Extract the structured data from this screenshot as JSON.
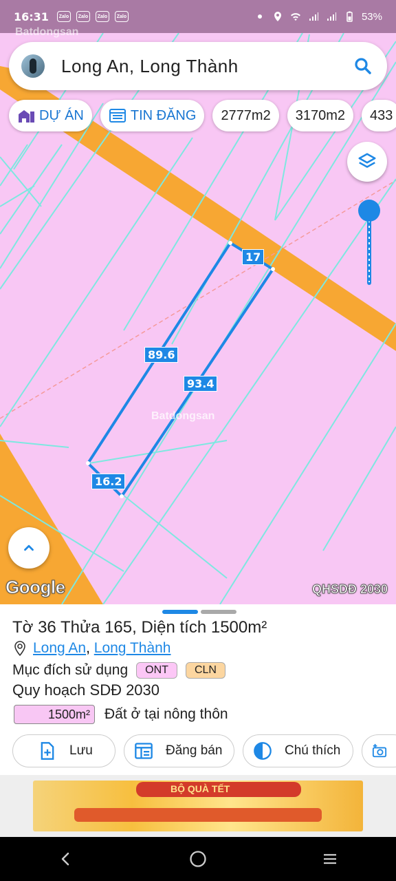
{
  "status_bar": {
    "time": "16:31",
    "notifications": [
      "Zalo",
      "Zalo",
      "Zalo",
      "Zalo"
    ],
    "battery": "53%"
  },
  "watermark": "Batdongsan",
  "search": {
    "query": "Long An, Long Thành",
    "search_icon": "search-icon"
  },
  "chips": [
    {
      "label": "DỰ ÁN",
      "icon": "building-icon",
      "accent": true
    },
    {
      "label": "TIN ĐĂNG",
      "icon": "listing-icon",
      "accent": true
    },
    {
      "label": "2777m2",
      "accent": false
    },
    {
      "label": "3170m2",
      "accent": false
    },
    {
      "label": "433",
      "accent": false
    }
  ],
  "map": {
    "edge_labels": {
      "top": "17",
      "left": "89.6",
      "right": "93.4",
      "bottom": "16.2"
    },
    "watermark": "Batdongsan",
    "google": "Google",
    "layer_name": "QHSDĐ 2030",
    "colors": {
      "residential": "#f8c7f4",
      "road": "#f7a733",
      "parcel_lines": "#7de8e0",
      "selection": "#1e88e5"
    }
  },
  "sheet": {
    "title": "Tờ 36 Thửa 165, Diện tích 1500m²",
    "location_province": "Long An",
    "location_separator": ", ",
    "location_district": "Long Thành",
    "purpose_label": "Mục đích sử dụng",
    "purpose_badges": [
      "ONT",
      "CLN"
    ],
    "planning": "Quy hoạch SDĐ 2030",
    "area_value": "1500m²",
    "area_desc": "Đất ở tại nông thôn",
    "actions": [
      {
        "label": "Lưu",
        "icon": "add-file-icon"
      },
      {
        "label": "Đăng bán",
        "icon": "listing-icon"
      },
      {
        "label": "Chú thích",
        "icon": "contrast-icon"
      },
      {
        "label": "",
        "icon": "add-photo-icon"
      }
    ]
  },
  "ad": {
    "text": "BỘ QUÀ TẾT"
  }
}
